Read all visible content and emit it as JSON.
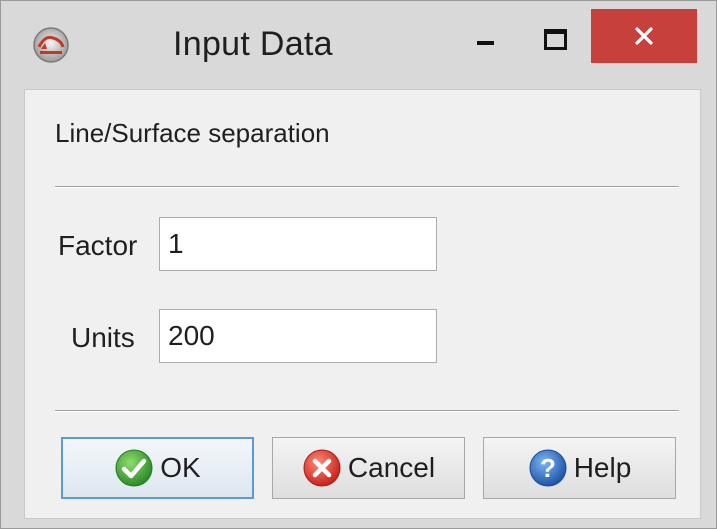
{
  "window": {
    "title": "Input Data",
    "app_icon": "app-logo-icon",
    "controls": {
      "minimize_icon": "minimize-icon",
      "maximize_icon": "maximize-icon",
      "close_icon": "close-icon"
    },
    "close_color": "#c7403b"
  },
  "dialog": {
    "section_label": "Line/Surface separation",
    "fields": {
      "factor": {
        "label": "Factor",
        "value": "1"
      },
      "units": {
        "label": "Units",
        "value": "200"
      }
    },
    "buttons": {
      "ok": {
        "label": "OK",
        "icon": "check-icon"
      },
      "cancel": {
        "label": "Cancel",
        "icon": "cancel-icon"
      },
      "help": {
        "label": "Help",
        "icon": "help-icon"
      }
    }
  },
  "colors": {
    "ok_green": "#3fa33a",
    "cancel_red": "#d9332b",
    "help_blue": "#1f63b8",
    "focus_border": "#5b9bd5"
  }
}
